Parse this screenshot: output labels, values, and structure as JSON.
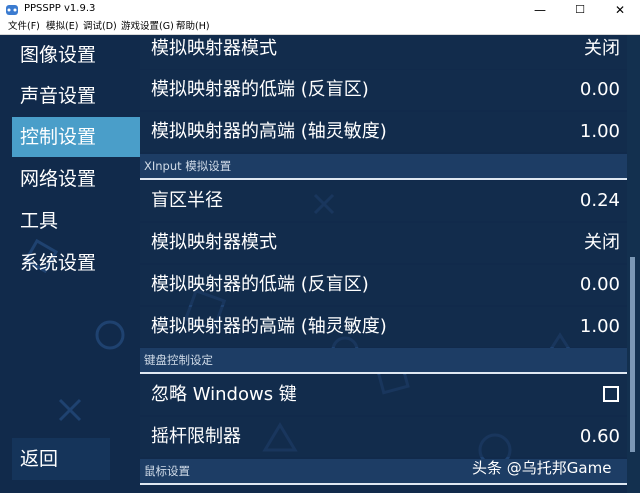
{
  "window": {
    "title": "PPSSPP v1.9.3",
    "minimize": "—",
    "maximize": "☐",
    "close": "✕"
  },
  "menu": [
    "文件(F)",
    "模拟(E)",
    "调试(D)",
    "游戏设置(G)",
    "帮助(H)"
  ],
  "sidebar": {
    "items": [
      "图像设置",
      "声音设置",
      "控制设置",
      "网络设置",
      "工具",
      "系统设置"
    ],
    "active": "控制设置",
    "back": "返回"
  },
  "settings": {
    "top_rows": [
      {
        "label": "模拟映射器模式",
        "value": "关闭"
      },
      {
        "label": "模拟映射器的低端 (反盲区)",
        "value": "0.00"
      },
      {
        "label": "模拟映射器的高端 (轴灵敏度)",
        "value": "1.00"
      }
    ],
    "xinput_header": "XInput 模拟设置",
    "xinput_rows": [
      {
        "label": "盲区半径",
        "value": "0.24"
      },
      {
        "label": "模拟映射器模式",
        "value": "关闭"
      },
      {
        "label": "模拟映射器的低端 (反盲区)",
        "value": "0.00"
      },
      {
        "label": "模拟映射器的高端 (轴灵敏度)",
        "value": "1.00"
      }
    ],
    "keyboard_header": "键盘控制设定",
    "keyboard_rows": [
      {
        "label": "忽略 Windows 键",
        "checked": false
      },
      {
        "label": "摇杆限制器",
        "value": "0.60"
      }
    ],
    "mouse_header": "鼠标设置"
  },
  "watermark": "头条 @乌托邦Game",
  "colors": {
    "background": "#112a4b",
    "active": "#4a9ec9",
    "header": "#1d3d65"
  }
}
